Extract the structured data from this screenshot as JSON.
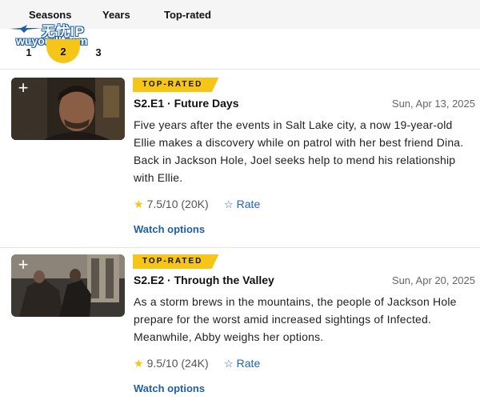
{
  "tabs": [
    "Seasons",
    "Years",
    "Top-rated"
  ],
  "watermark": {
    "brand": "无忧IP",
    "url": "wuyoudl.com"
  },
  "pager": {
    "pages": [
      "1",
      "2",
      "3"
    ],
    "selected": "2"
  },
  "episodes": [
    {
      "badge": "TOP-RATED",
      "title": "S2.E1 · Future Days",
      "date": "Sun, Apr 13, 2025",
      "description": "Five years after the events in Salt Lake city, a now 19-year-old Ellie makes a discovery while on patrol with her best friend Dina. Back in Jackson Hole, Joel seeks help to mend his relationship with Ellie.",
      "rating": "7.5/10 (20K)",
      "rate_label": "Rate",
      "watch_label": "Watch options"
    },
    {
      "badge": "TOP-RATED",
      "title": "S2.E2 · Through the Valley",
      "date": "Sun, Apr 20, 2025",
      "description": "As a storm brews in the mountains, the people of Jackson Hole prepare for the worst amid increased sightings of Infected. Meanwhile, Abby weighs her options.",
      "rating": "9.5/10 (24K)",
      "rate_label": "Rate",
      "watch_label": "Watch options"
    }
  ],
  "colors": {
    "accent": "#f5c518",
    "link": "#1f5fa8",
    "bar": "#f5f5f5"
  },
  "icons": {
    "add": "plus-icon",
    "rating": "star-filled-icon",
    "rate": "star-outline-icon"
  }
}
